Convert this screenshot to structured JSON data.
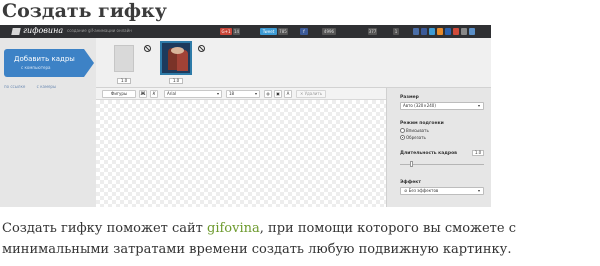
{
  "heading": "Создать гифку",
  "screenshot": {
    "topbar": {
      "logo": "гифовина",
      "slogan": "создание gif-анимации онлайн",
      "social_buttons": [
        {
          "label": "G+1",
          "count": "14",
          "color": "#c9473a"
        },
        {
          "label": "Tweet",
          "count": "785",
          "color": "#3d9bd4"
        },
        {
          "label": "f",
          "count": "4996",
          "color": "#3b5a98"
        }
      ],
      "right_counts": [
        "377",
        "1"
      ]
    },
    "left": {
      "add_button_title": "Добавить кадры",
      "add_button_subtitle": "с компьютера",
      "link_url": "по ссылке",
      "link_camera": "с камеры"
    },
    "frames": {
      "durations": [
        "1.0",
        "1.0"
      ]
    },
    "toolbar": {
      "shapes": "Фигуры",
      "bold": "Ж",
      "italic": "К",
      "font": "Arial",
      "size": "18",
      "delete": "Удалить"
    },
    "settings": {
      "size_label": "Размер",
      "size_value": "Авто (320×240)",
      "fit_label": "Режим подгонки",
      "fit_options": [
        "Вписывать",
        "Обрезать"
      ],
      "fit_selected": 1,
      "duration_label": "Длительность кадров",
      "duration_value": "1.0",
      "duration_fraction": 0.12,
      "effect_label": "Эффект",
      "effect_value": "Без эффектов"
    }
  },
  "paragraph": {
    "before": "Создать гифку поможет сайт ",
    "link": "gifovina",
    "after": ", при помощи которого вы сможете с минимальными затратами времени создать любую подвижную картинку."
  }
}
